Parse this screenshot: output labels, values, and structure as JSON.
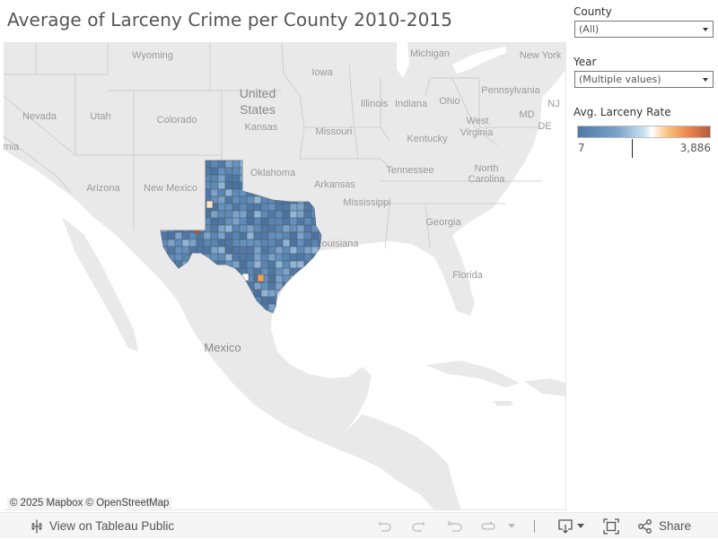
{
  "title": "Average of Larceny Crime per County 2010-2015",
  "filters": {
    "county": {
      "label": "County",
      "value": "(All)"
    },
    "year": {
      "label": "Year",
      "value": "(Multiple values)"
    }
  },
  "legend": {
    "title": "Avg. Larceny Rate",
    "min": "7",
    "max": "3,886",
    "colors": {
      "low": "#4e79a7",
      "mid": "#ffffff",
      "high": "#b45a3c"
    }
  },
  "map": {
    "attribution": "© 2025 Mapbox  © OpenStreetMap",
    "labels": {
      "country_us_1": "United",
      "country_us_2": "States",
      "country_mx": "Mexico",
      "states": {
        "wyoming": "Wyoming",
        "michigan": "Michigan",
        "new_york": "New York",
        "iowa": "Iowa",
        "pennsylvania": "Pennsylvania",
        "nevada": "Nevada",
        "utah": "Utah",
        "colorado": "Colorado",
        "illinois": "Illinois",
        "indiana": "Indiana",
        "ohio": "Ohio",
        "nj": "NJ",
        "kansas": "Kansas",
        "missouri": "Missouri",
        "west": "West",
        "virginia": "Virginia",
        "md": "MD",
        "de": "DE",
        "kentucky": "Kentucky",
        "california": "ornia",
        "oklahoma": "Oklahoma",
        "tennessee": "Tennessee",
        "north": "North",
        "carolina": "Carolina",
        "arizona": "Arizona",
        "new_mexico": "New Mexico",
        "arkansas": "Arkansas",
        "mississippi": "Mississippi",
        "georgia": "Georgia",
        "louisiana": "Louisiana",
        "florida": "Florida"
      }
    },
    "highlight_state": "Texas",
    "outlier_counties": [
      {
        "position": "west-panhandle",
        "color": "#b45a3c"
      },
      {
        "position": "south-central",
        "color": "#f4a04a"
      },
      {
        "position": "south-west",
        "color": "#ffffff"
      },
      {
        "position": "panhandle-west",
        "color": "#fde3c6"
      }
    ]
  },
  "toolbar": {
    "view_on_label": "View on Tableau Public",
    "share_label": "Share"
  }
}
